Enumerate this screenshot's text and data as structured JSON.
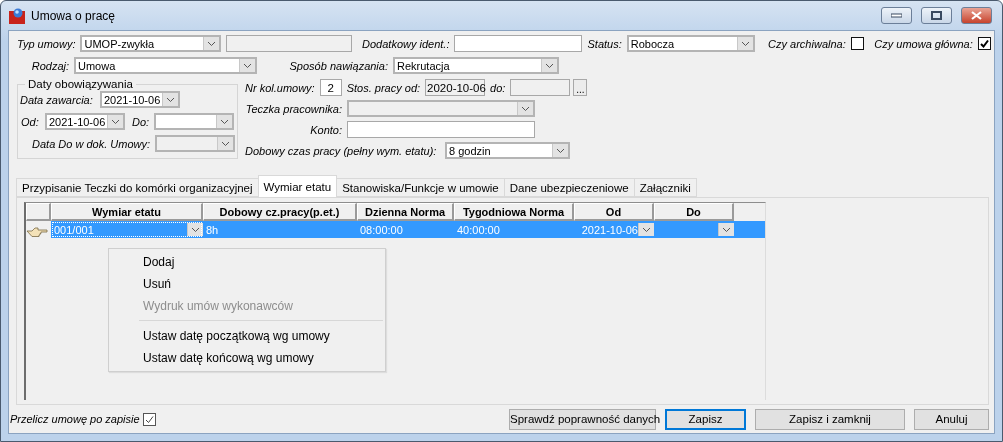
{
  "window": {
    "title": "Umowa o pracę"
  },
  "typ_umowy": {
    "label": "Typ umowy:",
    "value": "UMOP-zwykła"
  },
  "numer_umowy": {
    "disabled": true
  },
  "dodatkowy_ident": {
    "label": "Dodatkowy ident.:"
  },
  "status": {
    "label": "Status:",
    "value": "Robocza"
  },
  "czy_archiwalna": {
    "label": "Czy archiwalna:",
    "checked": false
  },
  "czy_umowa_glowna": {
    "label": "Czy umowa główna:",
    "checked": true
  },
  "rodzaj": {
    "label": "Rodzaj:",
    "value": "Umowa"
  },
  "sposob_nawiazania": {
    "label": "Sposób nawiązania:",
    "value": "Rekrutacja"
  },
  "daty": {
    "legend": "Daty obowiązywania",
    "data_zawarcia": {
      "label": "Data zawarcia:",
      "value": "2021-10-06"
    },
    "od": {
      "label": "Od:",
      "value": "2021-10-06"
    },
    "do": {
      "label": "Do:"
    },
    "data_do_w_dok": {
      "label": "Data Do w dok. Umowy:",
      "disabled": true
    }
  },
  "nr_kol_umowy": {
    "label": "Nr kol.umowy:",
    "value": "2"
  },
  "stos_pracy_od": {
    "label": "Stos. pracy od:",
    "value": "2020-10-06",
    "disabled": true
  },
  "stos_pracy_do": {
    "label": "do:",
    "disabled": true
  },
  "browse_button": "...",
  "teczka": {
    "label": "Teczka pracownika:",
    "disabled": true
  },
  "konto": {
    "label": "Konto:"
  },
  "dobowy_czas": {
    "label": "Dobowy czas pracy (pełny wym. etatu):",
    "value": "8 godzin"
  },
  "tabs": [
    {
      "label": "Przypisanie Teczki do komórki organizacyjnej",
      "selected": false
    },
    {
      "label": "Wymiar etatu",
      "selected": true
    },
    {
      "label": "Stanowiska/Funkcje w umowie",
      "selected": false
    },
    {
      "label": "Dane ubezpieczeniowe",
      "selected": false
    },
    {
      "label": "Załączniki",
      "selected": false
    }
  ],
  "grid": {
    "columns": [
      "Wymiar etatu",
      "Dobowy cz.pracy(p.et.)",
      "Dzienna Norma",
      "Tygodniowa Norma",
      "Od",
      "Do"
    ],
    "rows": [
      {
        "selected": true,
        "cells": [
          {
            "text": "001/001",
            "combo": true
          },
          {
            "text": "8h"
          },
          {
            "text": "08:00:00"
          },
          {
            "text": "40:00:00"
          },
          {
            "text": "2021-10-06",
            "combo": true
          },
          {
            "combo": true
          }
        ]
      }
    ]
  },
  "context_menu": [
    {
      "kind": "item",
      "label": "Dodaj",
      "disabled": false
    },
    {
      "kind": "item",
      "label": "Usuń",
      "disabled": false
    },
    {
      "kind": "item",
      "label": "Wydruk umów wykonawców",
      "disabled": true
    },
    {
      "kind": "separator"
    },
    {
      "kind": "item",
      "label": "Ustaw datę początkową wg umowy",
      "disabled": false
    },
    {
      "kind": "item",
      "label": "Ustaw datę końcową wg umowy",
      "disabled": false
    }
  ],
  "przelicz": {
    "label": "Przelicz umowę po zapisie",
    "checked": true
  },
  "buttons": [
    {
      "label": "Sprawdź poprawność danych",
      "focused": false
    },
    {
      "label": "Zapisz",
      "focused": true
    },
    {
      "label": "Zapisz i zamknij",
      "focused": false
    },
    {
      "label": "Anuluj",
      "focused": false
    }
  ]
}
